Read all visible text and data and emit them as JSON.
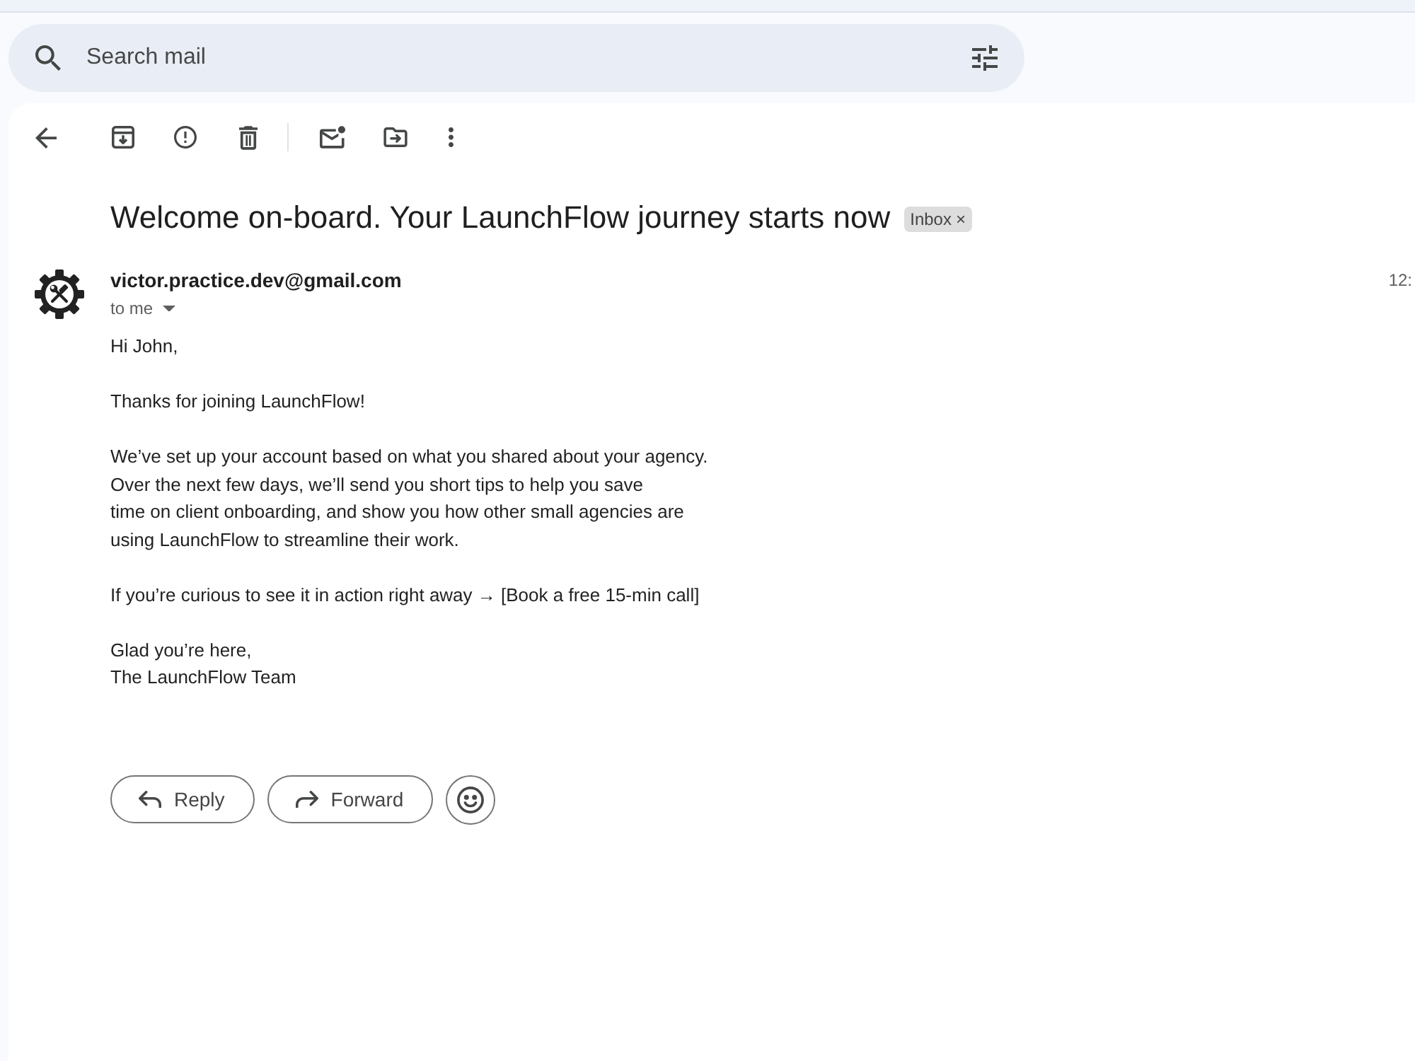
{
  "search": {
    "placeholder": "Search mail"
  },
  "message": {
    "subject": "Welcome on-board. Your LaunchFlow journey starts now",
    "labels": [
      {
        "label": "Inbox",
        "remove": "×"
      }
    ],
    "sender": "victor.practice.dev@gmail.com",
    "recipient": "to me",
    "time": "12:",
    "body": [
      [
        "Hi John,"
      ],
      [
        "Thanks for joining LaunchFlow!"
      ],
      [
        "We’ve set up your account based on what you shared about your agency.",
        "Over the next few days, we’ll send you short tips to help you save",
        "time on client onboarding, and show you how other small agencies are",
        "using LaunchFlow to streamline their work."
      ],
      [
        "If you’re curious to see it in action right away → [Book a free 15-min call]"
      ],
      [
        "Glad you’re here,",
        "The LaunchFlow Team"
      ]
    ]
  },
  "actions": [
    {
      "kind": "reply",
      "label": "Reply"
    },
    {
      "kind": "forward",
      "label": "Forward"
    },
    {
      "kind": "emoji"
    }
  ]
}
